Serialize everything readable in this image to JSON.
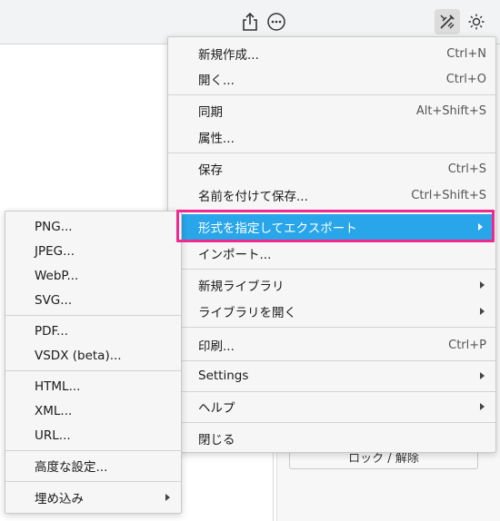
{
  "toolbar": {
    "icons": [
      "share-icon",
      "more-icon",
      "format-icon",
      "theme-icon"
    ]
  },
  "panel": {
    "lock_label": "ロック / 解除"
  },
  "main_menu": {
    "new": {
      "label": "新規作成...",
      "shortcut": "Ctrl+N"
    },
    "open": {
      "label": "開く...",
      "shortcut": "Ctrl+O"
    },
    "sync": {
      "label": "同期",
      "shortcut": "Alt+Shift+S"
    },
    "properties": {
      "label": "属性..."
    },
    "save": {
      "label": "保存",
      "shortcut": "Ctrl+S"
    },
    "save_as": {
      "label": "名前を付けて保存...",
      "shortcut": "Ctrl+Shift+S"
    },
    "export_as": {
      "label": "形式を指定してエクスポート"
    },
    "import": {
      "label": "インポート..."
    },
    "new_library": {
      "label": "新規ライブラリ"
    },
    "open_library": {
      "label": "ライブラリを開く"
    },
    "print": {
      "label": "印刷...",
      "shortcut": "Ctrl+P"
    },
    "settings": {
      "label": "Settings"
    },
    "help": {
      "label": "ヘルプ"
    },
    "close": {
      "label": "閉じる"
    }
  },
  "sub_menu": {
    "png": "PNG...",
    "jpeg": "JPEG...",
    "webp": "WebP...",
    "svg": "SVG...",
    "pdf": "PDF...",
    "vsdx": "VSDX (beta)...",
    "html": "HTML...",
    "xml": "XML...",
    "url": "URL...",
    "advanced": "高度な設定...",
    "embed": "埋め込み"
  },
  "colors": {
    "selected_bg": "#29a6ea",
    "highlight_frame": "#ee2a8f",
    "menu_bg": "#f6f6f6"
  }
}
